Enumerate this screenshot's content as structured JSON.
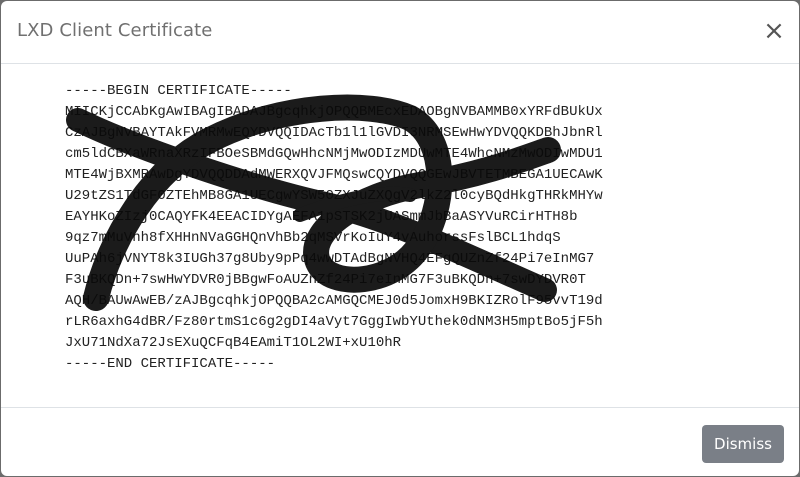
{
  "dialog": {
    "title": "LXD Client Certificate",
    "close_symbol": "×",
    "dismiss_label": "Dismiss"
  },
  "certificate": {
    "lines": [
      "-----BEGIN CERTIFICATE-----",
      "MIICKjCCAbKgAwIBAgIBADAJBgcqhkjOPQQBMEcxEDAOBgNVBAMMB0xYRFdBUkUx",
      "CzAJBgNVBAYTAkFVMRMwEQYDVQQIDAcTb1l1lGVDI3NRMSEwHwYDVQQKDBhJbnRl",
      "cm5ldCBXaWRnaXRzIFBOeSBMdGQwHhcNMjMwODIzMDUwMTE4WhcNMzMwODIwMDU1",
      "MTE4WjBXMRAwDgYDVQQDDAdMWERXQVJFMQswCQYDVQQGEwJBVTETMBEGA1UECAwK",
      "U29tZS1TdGF0ZTEhMB8GA1UECgwYSW50ZXJuZXQgV2lkZ2l0cyBQdHkgTHRkMHYw",
      "EAYHKoZIzj0CAQYFK4EEACIDYgAEFA1pSTSK2jUASmmJbBaASYVuRCirHTH8b",
      "9qz7mMuVnh8fXHHnNVaGGHQnVhBb2qMSVrKoIuY4vAuhorssFslBCL1hdqS",
      "UuPAh6jVNYT8k3IUGh37g8Uby9pPq4wwDTAdBgNVHQ4EFgQUZnZf24Pi7eInMG7",
      "F3uBKQDn+7swHwYDVR0jBBgwFoAUZnZf24Pi7eInMG7F3uBKQDn+7swDYDVR0T",
      "AQH/BAUwAwEB/zAJBgcqhkjOPQQBA2cAMGQCMEJ0d5JomxH9BKIZRolF95vvT19d",
      "rLR6axhG4dBR/Fz80rtmS1c6g2gDI4aVyt7GggIwbYUthek0dNM3H5mptBo5jF5h",
      "JxU71NdXa72JsEXuQCFqB4EAmiT1OL2WI+xU10hR",
      "-----END CERTIFICATE-----"
    ]
  }
}
